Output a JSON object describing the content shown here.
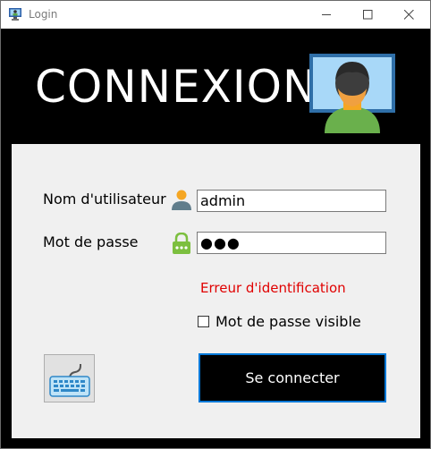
{
  "window": {
    "title": "Login",
    "controls": {
      "minimize": "minimize",
      "maximize": "maximize",
      "close": "close"
    }
  },
  "header": {
    "title": "CONNEXION",
    "image": "user-at-monitor-icon"
  },
  "form": {
    "username_label": "Nom d'utilisateur",
    "username_value": "admin",
    "password_label": "Mot de passe",
    "password_value": "●●●",
    "error_message": "Erreur d'identification",
    "show_password_label": "Mot de passe visible",
    "show_password_checked": false,
    "keyboard_button_icon": "keyboard-icon",
    "submit_label": "Se connecter"
  },
  "colors": {
    "background": "#000000",
    "panel": "#f0f0f0",
    "error": "#e00000",
    "focus_border": "#0078d7",
    "avatar_shirt": "#6ab04c",
    "lock": "#7cbf3f"
  }
}
